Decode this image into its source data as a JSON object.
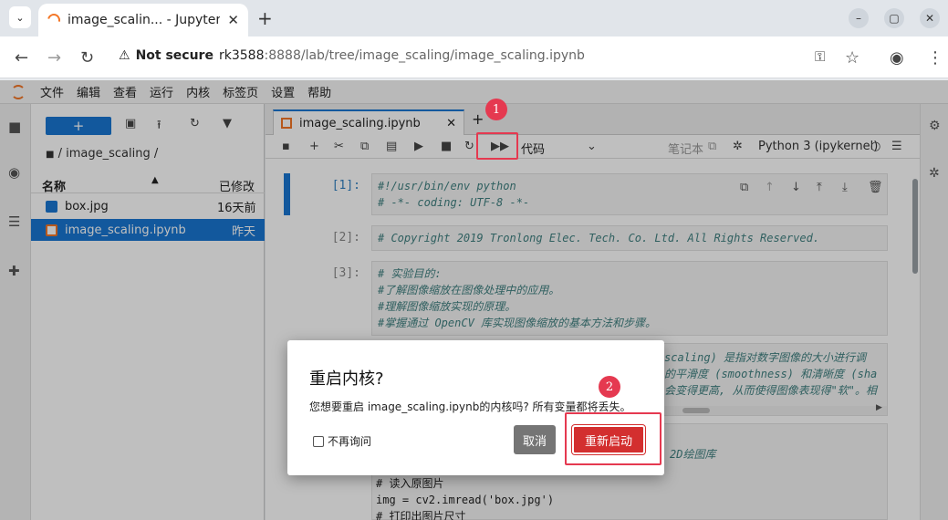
{
  "browser": {
    "tab_title": "image_scalin... - Jupyter",
    "new_tab": "+",
    "not_secure": "Not secure",
    "url_host": "rk3588",
    "url_rest": ":8888/lab/tree/image_scaling/image_scaling.ipynb",
    "window_min": "–",
    "window_max": "▢",
    "window_close": "✕"
  },
  "menubar": {
    "items": [
      "文件",
      "编辑",
      "查看",
      "运行",
      "内核",
      "标签页",
      "设置",
      "帮助"
    ]
  },
  "filebrowser": {
    "new_label": "+",
    "breadcrumb": "/ image_scaling /",
    "col_name": "名称",
    "col_modified": "已修改",
    "files": [
      {
        "name": "box.jpg",
        "modified": "16天前"
      },
      {
        "name": "image_scaling.ipynb",
        "modified": "昨天"
      }
    ]
  },
  "notebook": {
    "tab_title": "image_scaling.ipynb",
    "cell_type": "代码",
    "notebook_label": "笔记本",
    "kernel_name": "Python 3 (ipykernel)",
    "cells": [
      {
        "prompt": "[1]:",
        "code": "#!/usr/bin/env python\n# -*- coding: UTF-8 -*-"
      },
      {
        "prompt": "[2]:",
        "code": "# Copyright 2019 Tronlong Elec. Tech. Co. Ltd. All Rights Reserved."
      },
      {
        "prompt": "[3]:",
        "code": "# 实验目的:\n#了解图像缩放在图像处理中的应用。\n#理解图像缩放实现的原理。\n#掌握通过 OpenCV 库实现图像缩放的基本方法和步骤。"
      }
    ],
    "partial_cell_right": "scaling) 是指对数字图像的大小进行调\n的平滑度 (smoothness) 和清晰度 (sha\n会变得更高, 从而使得图像表现得\"软\"。相",
    "partial_cell_lower_right": "2D绘图库",
    "partial_cell_bottom": "# 读入原图片\nimg = cv2.imread('box.jpg')\n# 打印出图片尺寸"
  },
  "dialog": {
    "title": "重启内核?",
    "body": "您想要重启 image_scaling.ipynb的内核吗? 所有变量都将丢失。",
    "checkbox_label": "不再询问",
    "cancel": "取消",
    "restart": "重新启动"
  },
  "annotations": {
    "badge1": "1",
    "badge2": "2"
  },
  "colors": {
    "accent": "#1976d2",
    "danger": "#d32f2f",
    "annotation": "#e53950",
    "jupyter_orange": "#f37626"
  }
}
